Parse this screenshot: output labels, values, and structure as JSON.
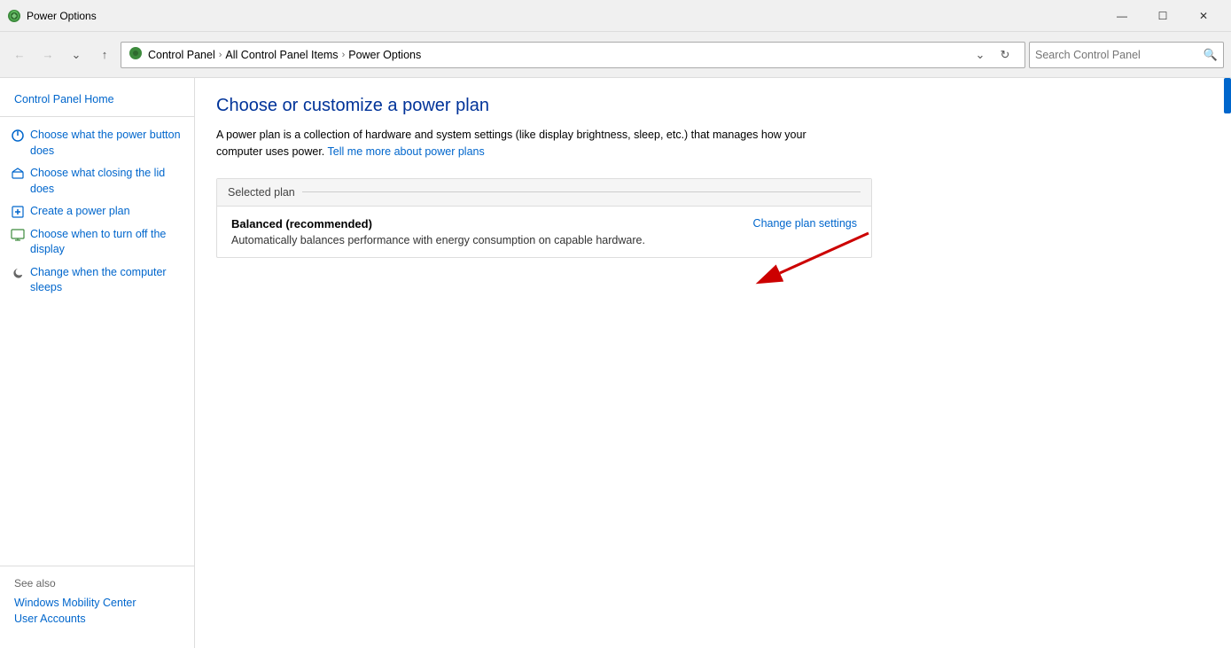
{
  "titlebar": {
    "icon": "⚡",
    "title": "Power Options",
    "minimize": "—",
    "maximize": "☐",
    "close": "✕"
  },
  "addressbar": {
    "breadcrumb": {
      "icon": "🌐",
      "parts": [
        "Control Panel",
        "All Control Panel Items",
        "Power Options"
      ]
    },
    "dropdown": "⌄",
    "refresh": "↻",
    "search_placeholder": "Search Control Panel",
    "search_icon": "🔍"
  },
  "sidebar": {
    "home_label": "Control Panel Home",
    "links": [
      {
        "text": "Choose what the power button does",
        "icon": "power"
      },
      {
        "text": "Choose what closing the lid does",
        "icon": "lid"
      },
      {
        "text": "Create a power plan",
        "icon": "plan"
      },
      {
        "text": "Choose when to turn off the display",
        "icon": "display"
      },
      {
        "text": "Change when the computer sleeps",
        "icon": "sleep"
      }
    ],
    "see_also_label": "See also",
    "see_also_links": [
      "Windows Mobility Center",
      "User Accounts"
    ]
  },
  "content": {
    "title": "Choose or customize a power plan",
    "description": "A power plan is a collection of hardware and system settings (like display brightness, sleep, etc.) that manages how your computer uses power.",
    "learn_more_text": "Tell me more about power plans",
    "selected_plan_label": "Selected plan",
    "plan": {
      "name": "Balanced (recommended)",
      "description": "Automatically balances performance with energy consumption on capable hardware.",
      "change_link": "Change plan settings"
    }
  }
}
